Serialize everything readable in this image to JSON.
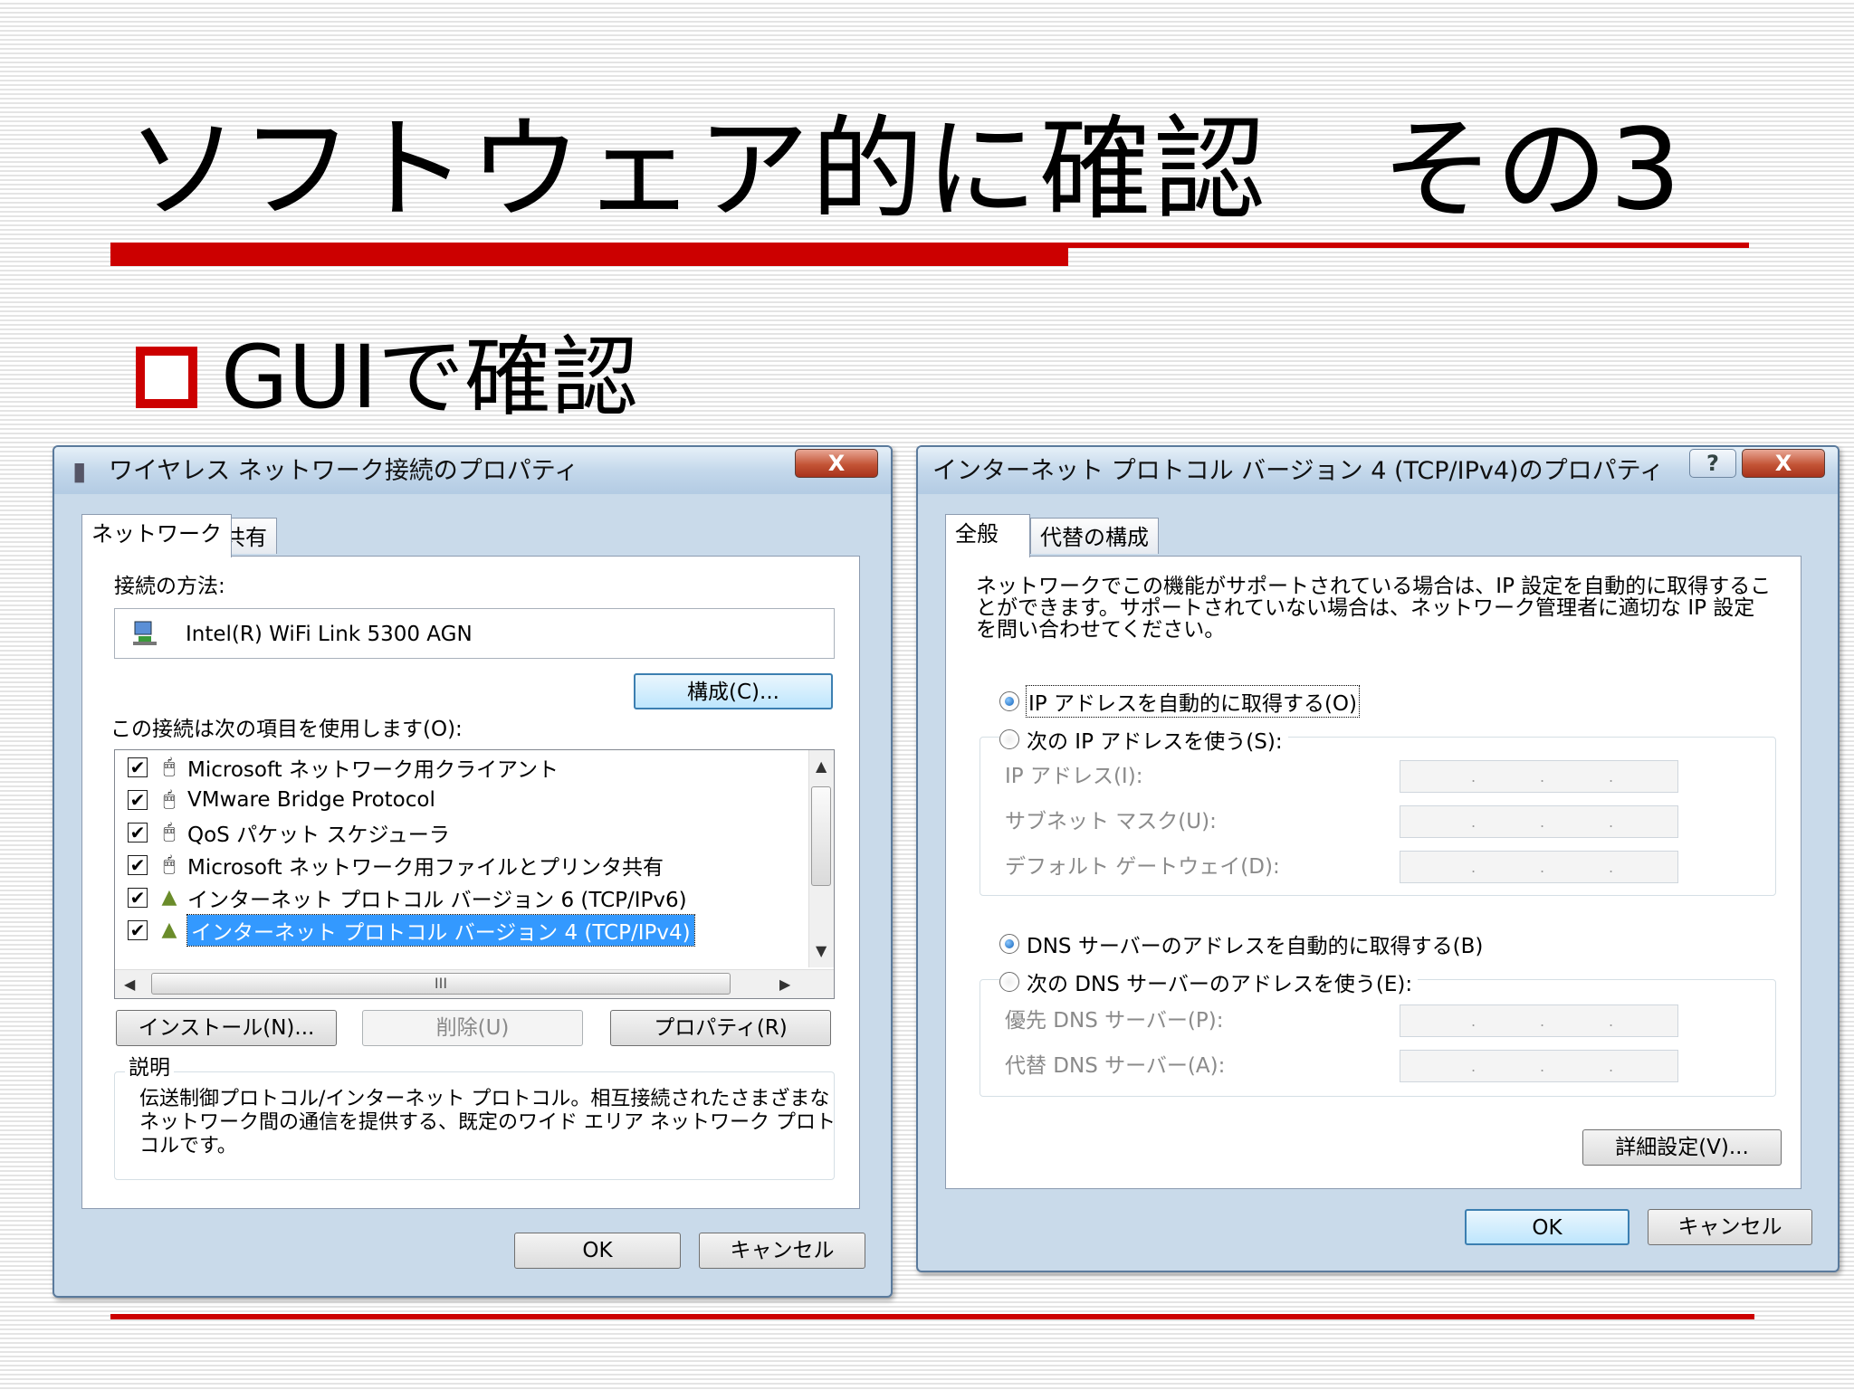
{
  "slide": {
    "title": "ソフトウェア的に確認　その3",
    "bullet": "GUIで確認"
  },
  "dialog1": {
    "title": "ワイヤレス ネットワーク接続のプロパティ",
    "close_label": "X",
    "tabs": [
      "ネットワーク",
      "共有"
    ],
    "connect_using_label": "接続の方法:",
    "adapter_name": "Intel(R) WiFi Link 5300 AGN",
    "configure_button": "構成(C)...",
    "items_label": "この接続は次の項目を使用します(O):",
    "items": [
      {
        "label": "Microsoft ネットワーク用クライアント",
        "checked": true,
        "icon": "network-client-icon"
      },
      {
        "label": "VMware Bridge Protocol",
        "checked": true,
        "icon": "network-service-icon"
      },
      {
        "label": "QoS パケット スケジューラ",
        "checked": true,
        "icon": "network-service-icon"
      },
      {
        "label": "Microsoft ネットワーク用ファイルとプリンタ共有",
        "checked": true,
        "icon": "network-service-icon"
      },
      {
        "label": "インターネット プロトコル バージョン 6 (TCP/IPv6)",
        "checked": true,
        "icon": "protocol-icon"
      },
      {
        "label": "インターネット プロトコル バージョン 4 (TCP/IPv4)",
        "checked": true,
        "icon": "protocol-icon",
        "selected": true
      }
    ],
    "hscroll_grip": "III",
    "install_button": "インストール(N)...",
    "uninstall_button": "削除(U)",
    "properties_button": "プロパティ(R)",
    "description_label": "説明",
    "description_text": "伝送制御プロトコル/インターネット プロトコル。相互接続されたさまざまなネットワーク間の通信を提供する、既定のワイド エリア ネットワーク プロトコルです。",
    "ok_button": "OK",
    "cancel_button": "キャンセル"
  },
  "dialog2": {
    "title": "インターネット プロトコル バージョン 4 (TCP/IPv4)のプロパティ",
    "help_label": "?",
    "close_label": "X",
    "tabs": [
      "全般",
      "代替の構成"
    ],
    "intro_text": "ネットワークでこの機能がサポートされている場合は、IP 設定を自動的に取得することができます。サポートされていない場合は、ネットワーク管理者に適切な IP 設定を問い合わせてください。",
    "ip_auto_radio": "IP アドレスを自動的に取得する(O)",
    "ip_manual_radio": "次の IP アドレスを使う(S):",
    "ip_address_label": "IP アドレス(I):",
    "subnet_label": "サブネット マスク(U):",
    "gateway_label": "デフォルト ゲートウェイ(D):",
    "dns_auto_radio": "DNS サーバーのアドレスを自動的に取得する(B)",
    "dns_manual_radio": "次の DNS サーバーのアドレスを使う(E):",
    "dns_preferred_label": "優先 DNS サーバー(P):",
    "dns_alternate_label": "代替 DNS サーバー(A):",
    "ip_dot": ".",
    "advanced_button": "詳細設定(V)...",
    "ok_button": "OK",
    "cancel_button": "キャンセル"
  },
  "colors": {
    "accent_red": "#cc0000",
    "selection_blue": "#3399ff",
    "titlebar_blue": "#c4d8eb"
  }
}
